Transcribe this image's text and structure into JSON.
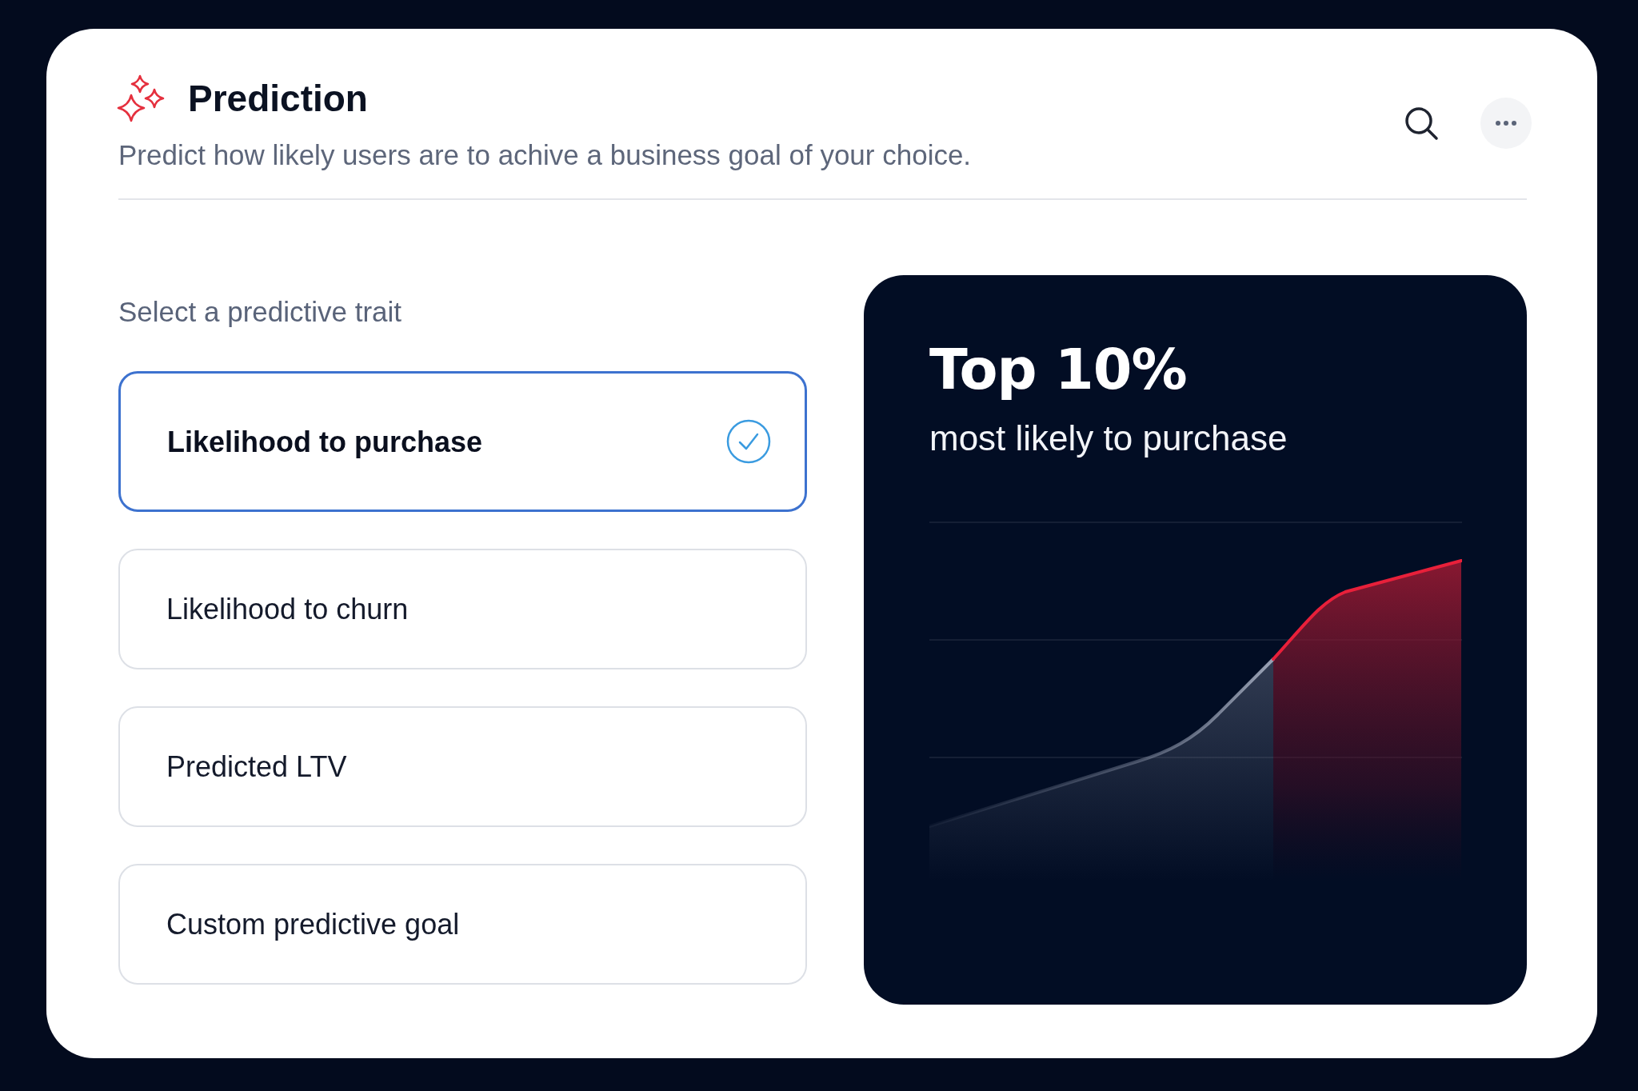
{
  "header": {
    "title": "Prediction",
    "subtitle": "Predict how likely users are to achive a business goal of your choice."
  },
  "prompt": "Select a predictive trait",
  "options": [
    {
      "label": "Likelihood to purchase",
      "selected": true
    },
    {
      "label": "Likelihood to churn",
      "selected": false
    },
    {
      "label": "Predicted LTV",
      "selected": false
    },
    {
      "label": "Custom predictive goal",
      "selected": false
    }
  ],
  "insight": {
    "headline": "Top 10%",
    "caption": "most likely to purchase"
  }
}
